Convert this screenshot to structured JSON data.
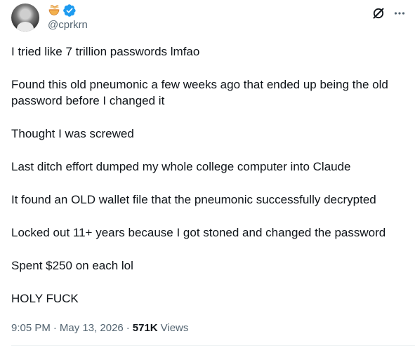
{
  "author": {
    "handle": "@cprkrn",
    "avatar_icon": "profile-photo",
    "name_emoji_icon": "noodle-bowl-icon",
    "verified_icon": "verified-badge-icon",
    "verified_color": "#1d9bf0"
  },
  "actions": {
    "grok_icon": "grok-icon",
    "more_icon": "more-horizontal-icon"
  },
  "post": {
    "paragraphs": [
      "I tried like 7 trillion passwords lmfao",
      "Found this old pneumonic a few weeks ago that ended up being the old password before I changed it",
      "Thought I was screwed",
      "Last ditch effort dumped my whole college computer into Claude",
      "It found an OLD wallet file that the pneumonic successfully decrypted",
      "Locked out 11+ years because I got stoned and changed the password",
      "Spent $250 on each lol",
      "HOLY FUCK"
    ]
  },
  "meta": {
    "time": "9:05 PM",
    "separator": "·",
    "date": "May 13, 2026",
    "views_count": "571K",
    "views_label": "Views"
  },
  "colors": {
    "text": "#0f1419",
    "secondary": "#536471",
    "accent": "#1d9bf0"
  }
}
